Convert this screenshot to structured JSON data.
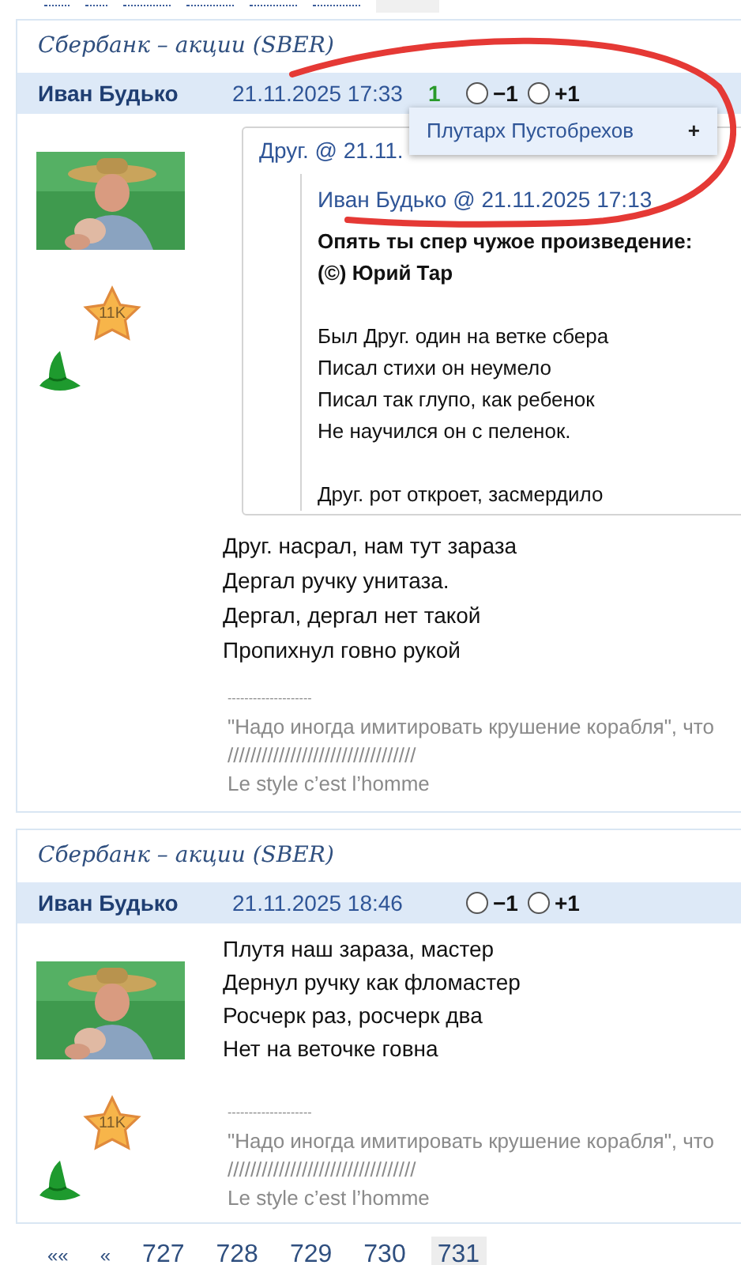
{
  "posts": [
    {
      "forum_title": "Сбербанк – акции (SBER)",
      "author": "Иван Будько",
      "datetime": "21.11.2025 17:33",
      "score": "1",
      "votes": [
        {
          "label": "−1",
          "selected": false
        },
        {
          "label": "+1",
          "selected": false
        }
      ],
      "badge": "11K",
      "quote": {
        "author_line": "Друг. @ 21.11.",
        "quote": {
          "author_line": "Иван Будько @ 21.11.2025 17:13",
          "bold_lines": [
            "Опять ты спер чужое произведение:",
            "(©) Юрий Тар"
          ],
          "stanzas": [
            [
              "Был Друг. один на ветке сбера",
              "Писал стихи он неумело",
              "Писал так глупо, как ребенок",
              "Не научился он с пеленок."
            ],
            [
              "Друг. рот откроет, засмердило"
            ]
          ]
        }
      },
      "body": [
        "Друг. насрал, нам тут зараза",
        "Дергал ручку унитаза.",
        "Дергал, дергал нет такой",
        "Пропихнул говно рукой"
      ],
      "signature": [
        "--------------------",
        "\"Надо иногда имитировать крушение корабля\", что",
        "/////////////////////////////////",
        "Le style c’est l’homme"
      ]
    },
    {
      "forum_title": "Сбербанк – акции (SBER)",
      "author": "Иван Будько",
      "datetime": "21.11.2025 18:46",
      "votes": [
        {
          "label": "−1",
          "selected": false
        },
        {
          "label": "+1",
          "selected": false
        }
      ],
      "badge": "11K",
      "body": [
        "Плутя наш зараза, мастер",
        "Дернул ручку как фломастер",
        "Росчерк раз, росчерк два",
        "Нет на веточке говна"
      ],
      "signature": [
        "--------------------",
        "\"Надо иногда имитировать крушение корабля\", что",
        "/////////////////////////////////",
        "Le style c’est l’homme"
      ]
    }
  ],
  "popup_menu": {
    "items": [
      {
        "label": "Плутарх Пустобрехов",
        "action": "+"
      }
    ]
  },
  "pagination": [
    {
      "label": "««",
      "selected": false
    },
    {
      "label": "«",
      "selected": false
    },
    {
      "label": "727",
      "selected": false
    },
    {
      "label": "728",
      "selected": false
    },
    {
      "label": "729",
      "selected": false
    },
    {
      "label": "730",
      "selected": false
    },
    {
      "label": "731",
      "selected": true
    }
  ]
}
